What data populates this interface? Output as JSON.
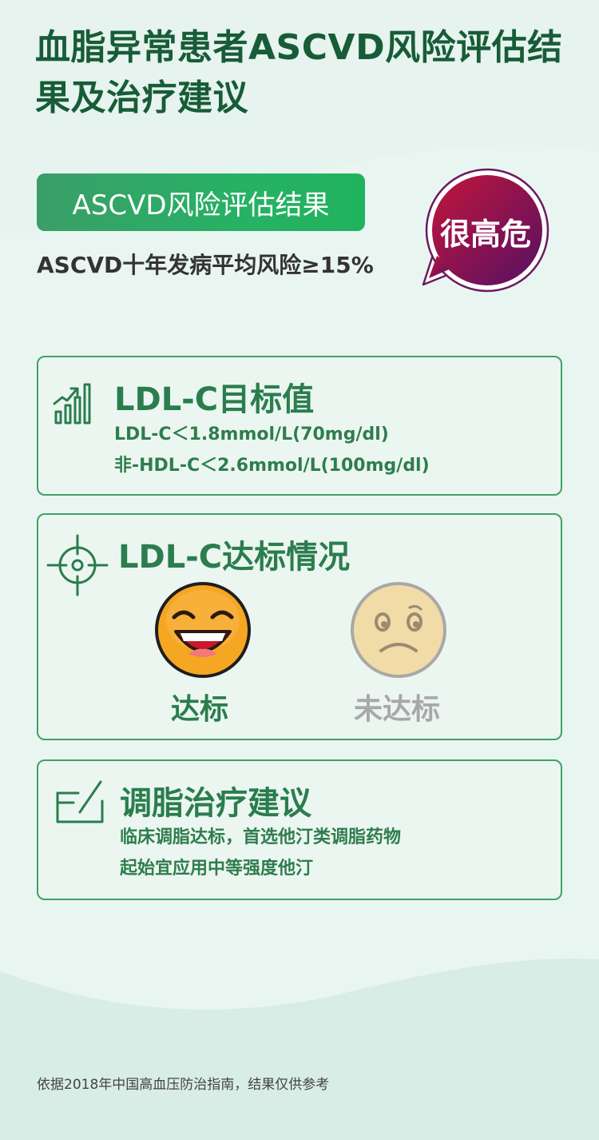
{
  "title": "血脂异常患者ASCVD风险评估结果及治疗建议",
  "result": {
    "label": "ASCVD风险评估结果",
    "risk_text": "ASCVD十年发病平均风险≥15%",
    "risk_level": "很高危"
  },
  "target_card": {
    "title": "LDL-C目标值",
    "lines": [
      "LDL-C＜1.8mmol/L(70mg/dl)",
      "非-HDL-C＜2.6mmol/L(100mg/dl)"
    ],
    "icon": "bar-chart-growth-icon"
  },
  "status_card": {
    "title": "LDL-C达标情况",
    "icon": "target-crosshair-icon",
    "options": [
      {
        "label": "达标",
        "icon": "happy-face-icon",
        "selected": true
      },
      {
        "label": "未达标",
        "icon": "sad-face-icon",
        "selected": false
      }
    ]
  },
  "advice_card": {
    "title": "调脂治疗建议",
    "icon": "edit-note-icon",
    "lines": [
      "临床调脂达标，首选他汀类调脂药物",
      "起始宜应用中等强度他汀"
    ]
  },
  "footer": "依据2018年中国高血压防治指南，结果仅供参考",
  "colors": {
    "primary_green": "#175c37",
    "accent_green": "#2b7d4d",
    "risk_gradient_start": "#b4123e",
    "risk_gradient_end": "#5a1060",
    "muted_gray": "#a8a8a8"
  }
}
